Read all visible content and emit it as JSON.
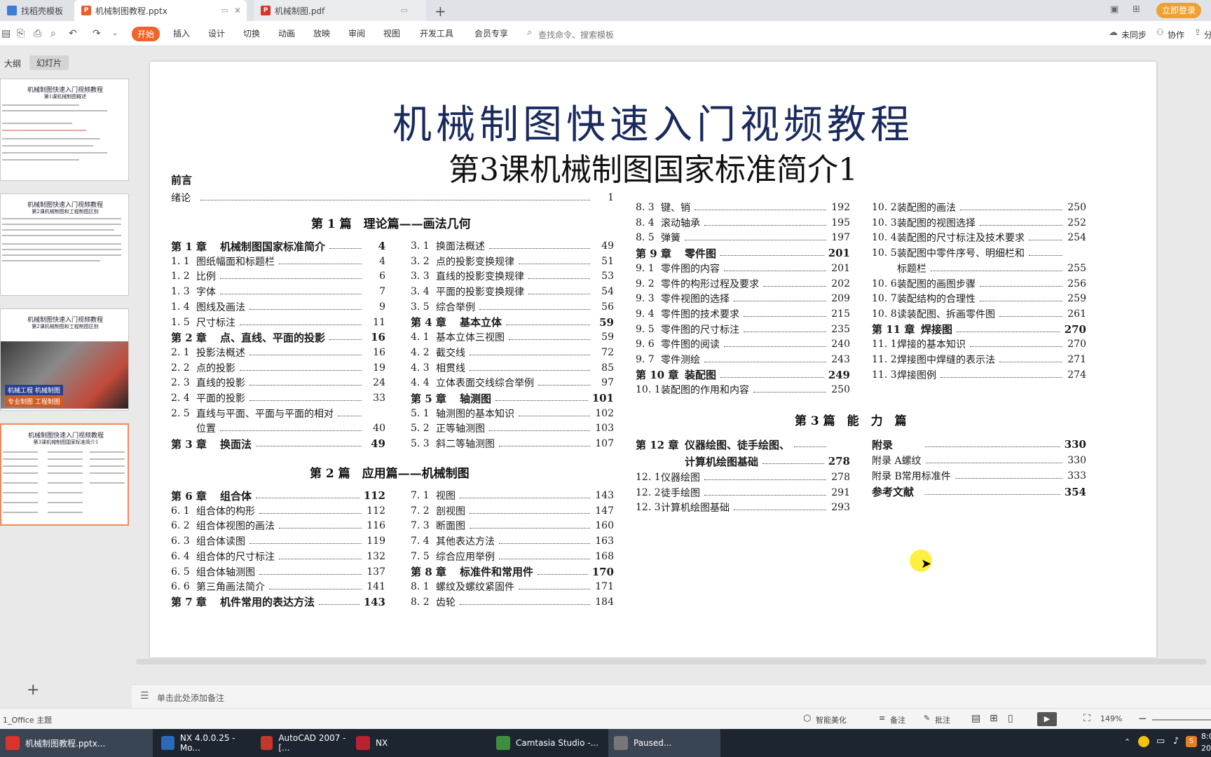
{
  "tabs": [
    {
      "label": "找稻壳模板"
    },
    {
      "label": "机械制图教程.pptx"
    },
    {
      "label": "机械制图.pdf"
    }
  ],
  "topright": {
    "login": "立即登录"
  },
  "menu": [
    "开始",
    "插入",
    "设计",
    "切换",
    "动画",
    "放映",
    "审阅",
    "视图",
    "开发工具",
    "会员专享"
  ],
  "search_placeholder": "查找命令、搜索模板",
  "menu_right": {
    "sync": "未同步",
    "collab": "协作",
    "share": "分"
  },
  "panel_tabs": {
    "outline": "大纲",
    "slides": "幻灯片"
  },
  "thumb_text": {
    "t1": "机械制图快速入门视频教程",
    "t1sub": "第1课机械制图概述",
    "t2sub": "第2课机械制图和工程制图区别",
    "t4sub": "第3课机械制图国家标准简介1",
    "t3banner1": "机械工程 机械制图",
    "t3banner2": "专业制图 工程制图"
  },
  "slide": {
    "title": "机械制图快速入门视频教程",
    "subtitle": "第3课机械制图国家标准简介1",
    "toc": {
      "col1": {
        "foreword": "前言",
        "intro": {
          "n": "绪论",
          "p": "1"
        },
        "part1": "第 1 篇　理论篇——画法几何",
        "rows1": [
          {
            "c": 1,
            "n": "第 1 章",
            "t": "机械制图国家标准简介",
            "p": "4"
          },
          {
            "n": "1. 1",
            "t": "图纸幅面和标题栏",
            "p": "4"
          },
          {
            "n": "1. 2",
            "t": "比例",
            "p": "6"
          },
          {
            "n": "1. 3",
            "t": "字体",
            "p": "7"
          },
          {
            "n": "1. 4",
            "t": "图线及画法",
            "p": "9"
          },
          {
            "n": "1. 5",
            "t": "尺寸标注",
            "p": "11"
          },
          {
            "c": 1,
            "n": "第 2 章",
            "t": "点、直线、平面的投影",
            "p": "16"
          },
          {
            "n": "2. 1",
            "t": "投影法概述",
            "p": "16"
          },
          {
            "n": "2. 2",
            "t": "点的投影",
            "p": "19"
          },
          {
            "n": "2. 3",
            "t": "直线的投影",
            "p": "24"
          },
          {
            "n": "2. 4",
            "t": "平面的投影",
            "p": "33"
          },
          {
            "n": "2. 5",
            "t": "直线与平面、平面与平面的相对",
            "p": ""
          },
          {
            "n": "",
            "t": "位置",
            "p": "40"
          },
          {
            "c": 1,
            "n": "第 3 章",
            "t": "换面法",
            "p": "49"
          }
        ],
        "part2": "第 2 篇　应用篇——机械制图",
        "rows2": [
          {
            "c": 1,
            "n": "第 6 章",
            "t": "组合体",
            "p": "112"
          },
          {
            "n": "6. 1",
            "t": "组合体的构形",
            "p": "112"
          },
          {
            "n": "6. 2",
            "t": "组合体视图的画法",
            "p": "116"
          },
          {
            "n": "6. 3",
            "t": "组合体读图",
            "p": "119"
          },
          {
            "n": "6. 4",
            "t": "组合体的尺寸标注",
            "p": "132"
          },
          {
            "n": "6. 5",
            "t": "组合体轴测图",
            "p": "137"
          },
          {
            "n": "6. 6",
            "t": "第三角画法简介",
            "p": "141"
          },
          {
            "c": 1,
            "n": "第 7 章",
            "t": "机件常用的表达方法",
            "p": "143"
          }
        ]
      },
      "col2": {
        "rows1": [
          {
            "n": "3. 1",
            "t": "换面法概述",
            "p": "49"
          },
          {
            "n": "3. 2",
            "t": "点的投影变换规律",
            "p": "51"
          },
          {
            "n": "3. 3",
            "t": "直线的投影变换规律",
            "p": "53"
          },
          {
            "n": "3. 4",
            "t": "平面的投影变换规律",
            "p": "54"
          },
          {
            "n": "3. 5",
            "t": "综合举例",
            "p": "56"
          },
          {
            "c": 1,
            "n": "第 4 章",
            "t": "基本立体",
            "p": "59"
          },
          {
            "n": "4. 1",
            "t": "基本立体三视图",
            "p": "59"
          },
          {
            "n": "4. 2",
            "t": "截交线",
            "p": "72"
          },
          {
            "n": "4. 3",
            "t": "相贯线",
            "p": "85"
          },
          {
            "n": "4. 4",
            "t": "立体表面交线综合举例",
            "p": "97"
          },
          {
            "c": 1,
            "n": "第 5 章",
            "t": "轴测图",
            "p": "101"
          },
          {
            "n": "5. 1",
            "t": "轴测图的基本知识",
            "p": "102"
          },
          {
            "n": "5. 2",
            "t": "正等轴测图",
            "p": "103"
          },
          {
            "n": "5. 3",
            "t": "斜二等轴测图",
            "p": "107"
          }
        ],
        "rows2": [
          {
            "n": "7. 1",
            "t": "视图",
            "p": "143"
          },
          {
            "n": "7. 2",
            "t": "剖视图",
            "p": "147"
          },
          {
            "n": "7. 3",
            "t": "断面图",
            "p": "160"
          },
          {
            "n": "7. 4",
            "t": "其他表达方法",
            "p": "163"
          },
          {
            "n": "7. 5",
            "t": "综合应用举例",
            "p": "168"
          },
          {
            "c": 1,
            "n": "第 8 章",
            "t": "标准件和常用件",
            "p": "170"
          },
          {
            "n": "8. 1",
            "t": "螺纹及螺纹紧固件",
            "p": "171"
          },
          {
            "n": "8. 2",
            "t": "齿轮",
            "p": "184"
          }
        ]
      },
      "col3": {
        "rows1": [
          {
            "n": "8. 3",
            "t": "键、销",
            "p": "192"
          },
          {
            "n": "8. 4",
            "t": "滚动轴承",
            "p": "195"
          },
          {
            "n": "8. 5",
            "t": "弹簧",
            "p": "197"
          },
          {
            "c": 1,
            "n": "第 9 章",
            "t": "零件图",
            "p": "201"
          },
          {
            "n": "9. 1",
            "t": "零件图的内容",
            "p": "201"
          },
          {
            "n": "9. 2",
            "t": "零件的构形过程及要求",
            "p": "202"
          },
          {
            "n": "9. 3",
            "t": "零件视图的选择",
            "p": "209"
          },
          {
            "n": "9. 4",
            "t": "零件图的技术要求",
            "p": "215"
          },
          {
            "n": "9. 5",
            "t": "零件图的尺寸标注",
            "p": "235"
          },
          {
            "n": "9. 6",
            "t": "零件图的阅读",
            "p": "240"
          },
          {
            "n": "9. 7",
            "t": "零件测绘",
            "p": "243"
          },
          {
            "c": 1,
            "n": "第 10 章",
            "t": "装配图",
            "p": "249"
          },
          {
            "n": "10. 1",
            "t": "装配图的作用和内容",
            "p": "250"
          }
        ],
        "part3": "第 3 篇　能　力　篇",
        "ch12a": {
          "n": "第 12 章",
          "t": "仪器绘图、徒手绘图、"
        },
        "ch12b": {
          "t": "计算机绘图基础",
          "p": "278"
        },
        "rows2": [
          {
            "n": "12. 1",
            "t": "仪器绘图",
            "p": "278"
          },
          {
            "n": "12. 2",
            "t": "徒手绘图",
            "p": "291"
          },
          {
            "n": "12. 3",
            "t": "计算机绘图基础",
            "p": "293"
          }
        ]
      },
      "col4": {
        "rows1": [
          {
            "n": "10. 2",
            "t": "装配图的画法",
            "p": "250"
          },
          {
            "n": "10. 3",
            "t": "装配图的视图选择",
            "p": "252"
          },
          {
            "n": "10. 4",
            "t": "装配图的尺寸标注及技术要求",
            "p": "254"
          },
          {
            "n": "10. 5",
            "t": "装配图中零件序号、明细栏和",
            "p": ""
          },
          {
            "n": "",
            "t": "标题栏",
            "p": "255"
          },
          {
            "n": "10. 6",
            "t": "装配图的画图步骤",
            "p": "256"
          },
          {
            "n": "10. 7",
            "t": "装配结构的合理性",
            "p": "259"
          },
          {
            "n": "10. 8",
            "t": "读装配图、拆画零件图",
            "p": "261"
          },
          {
            "c": 1,
            "n": "第 11 章",
            "t": "焊接图",
            "p": "270"
          },
          {
            "n": "11. 1",
            "t": "焊接的基本知识",
            "p": "270"
          },
          {
            "n": "11. 2",
            "t": "焊接图中焊缝的表示法",
            "p": "271"
          },
          {
            "n": "11. 3",
            "t": "焊接图例",
            "p": "274"
          }
        ],
        "rows2": [
          {
            "c": 1,
            "n": "附录",
            "t": "",
            "p": "330"
          },
          {
            "n": "附录 A",
            "t": "螺纹",
            "p": "330"
          },
          {
            "n": "附录 B",
            "t": "常用标准件",
            "p": "333"
          },
          {
            "c": 1,
            "n": "参考文献",
            "t": "",
            "p": "354"
          }
        ]
      }
    }
  },
  "notes_placeholder": "单击此处添加备注",
  "status": {
    "theme": "1_Office 主题",
    "beautify": "智能美化",
    "notes": "备注",
    "comment": "批注",
    "zoom": "149%"
  },
  "taskbar": [
    {
      "label": "机械制图教程.pptx...",
      "color": "#d9342b"
    },
    {
      "label": "NX 4.0.0.25 - Mo...",
      "color": "#2a6ab8"
    },
    {
      "label": "AutoCAD 2007 - [...",
      "color": "#c0392b"
    },
    {
      "label": "NX",
      "color": "#b8232f"
    },
    {
      "label": "Camtasia Studio -...",
      "color": "#3e8e41"
    },
    {
      "label": "Paused...",
      "color": "#777777"
    }
  ],
  "clock": {
    "time": "8:0",
    "date": "20"
  }
}
